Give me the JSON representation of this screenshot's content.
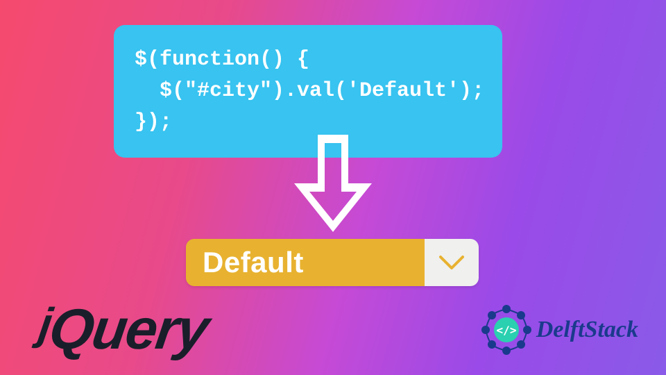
{
  "code": {
    "line1": "$(function() {",
    "line2": "  $(\"#city\").val('Default');",
    "line3": "});"
  },
  "dropdown": {
    "selected": "Default"
  },
  "logos": {
    "jquery": "Query",
    "jquery_j": "j",
    "delftstack": "DelftStack"
  },
  "colors": {
    "code_bg": "#38c3f0",
    "dropdown_bg": "#e8b230",
    "caret_color": "#e8b230",
    "delft_blue": "#1a3a8c"
  }
}
